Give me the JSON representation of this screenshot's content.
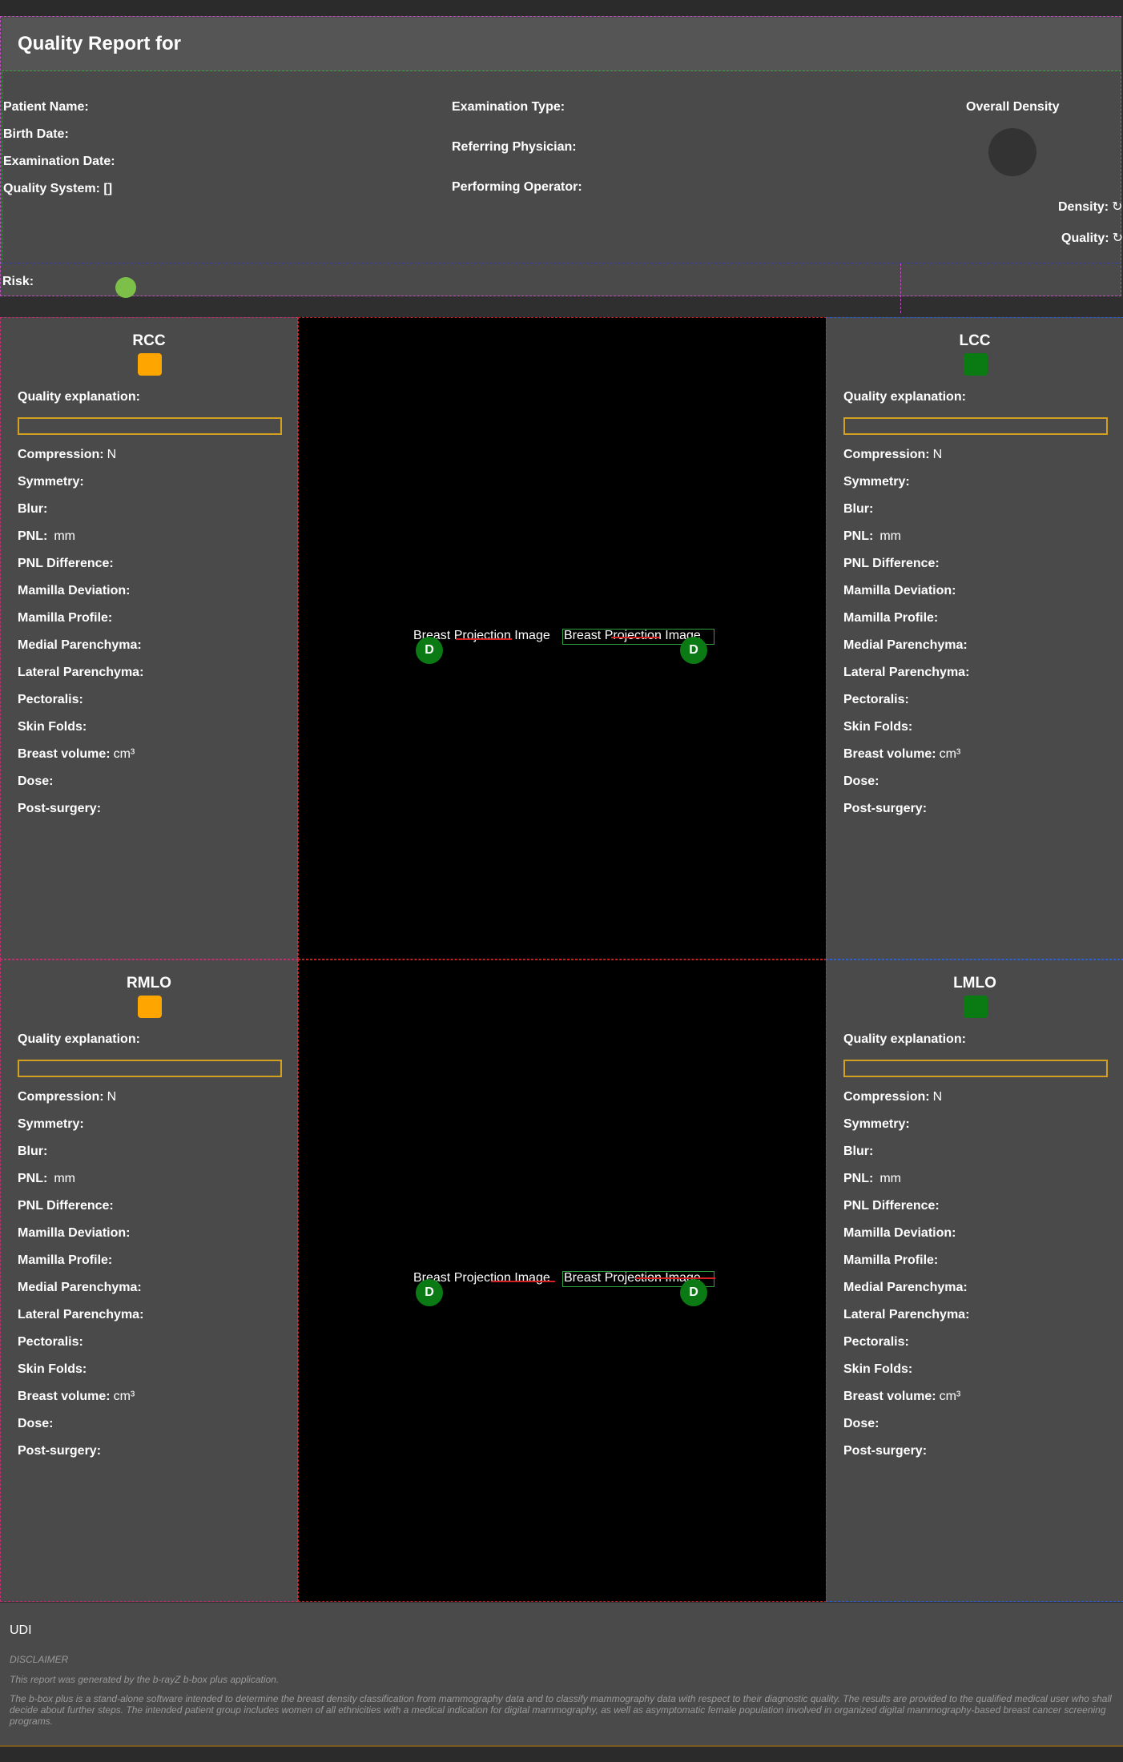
{
  "header": {
    "title": "Quality Report for",
    "patient_name_label": "Patient Name:",
    "birth_date_label": "Birth Date:",
    "examination_date_label": "Examination Date:",
    "quality_system_label": "Quality System: []",
    "examination_type_label": "Examination Type:",
    "referring_physician_label": "Referring Physician:",
    "performing_operator_label": "Performing Operator:",
    "overall_density_label": "Overall Density",
    "density_label": "Density:",
    "quality_label": "Quality:",
    "refresh_glyph": "↻",
    "risk_label": "Risk:",
    "risk_color": "#7cc04a"
  },
  "field_labels": {
    "quality_explanation": "Quality explanation:",
    "compression": "Compression:",
    "compression_value": "N",
    "symmetry": "Symmetry:",
    "blur": "Blur:",
    "pnl": "PNL:",
    "pnl_value": "mm",
    "pnl_difference": "PNL Difference:",
    "mamilla_deviation": "Mamilla Deviation:",
    "mamilla_profile": "Mamilla Profile:",
    "medial_parenchyma": "Medial Parenchyma:",
    "lateral_parenchyma": "Lateral Parenchyma:",
    "pectoralis": "Pectoralis:",
    "skin_folds": "Skin Folds:",
    "breast_volume": "Breast volume:",
    "breast_volume_value": "cm³",
    "dose": "Dose:",
    "post_surgery": "Post-surgery:"
  },
  "views": {
    "rcc": {
      "title": "RCC",
      "quality_color": "#ffa500"
    },
    "lcc": {
      "title": "LCC",
      "quality_color": "#0a7a12"
    },
    "rmlo": {
      "title": "RMLO",
      "quality_color": "#ffa500"
    },
    "lmlo": {
      "title": "LMLO",
      "quality_color": "#0a7a12"
    }
  },
  "images": {
    "alt_text": "Breast Projection Image",
    "marker_label": "D"
  },
  "footer": {
    "udi": "UDI",
    "disclaimer_heading": "DISCLAIMER",
    "generated_by": "This report was generated by the b-rayZ b-box plus application.",
    "body": "The b-box plus is a stand-alone software intended to determine the breast density classification from mammography data and to classify mammography data with respect to their diagnostic quality. The results are provided to the qualified medical user who shall decide about further steps. The intended patient group includes women of all ethnicities with a medical indication for digital mammography, as well as asymptomatic female population involved in organized digital mammography-based breast cancer screening programs."
  }
}
